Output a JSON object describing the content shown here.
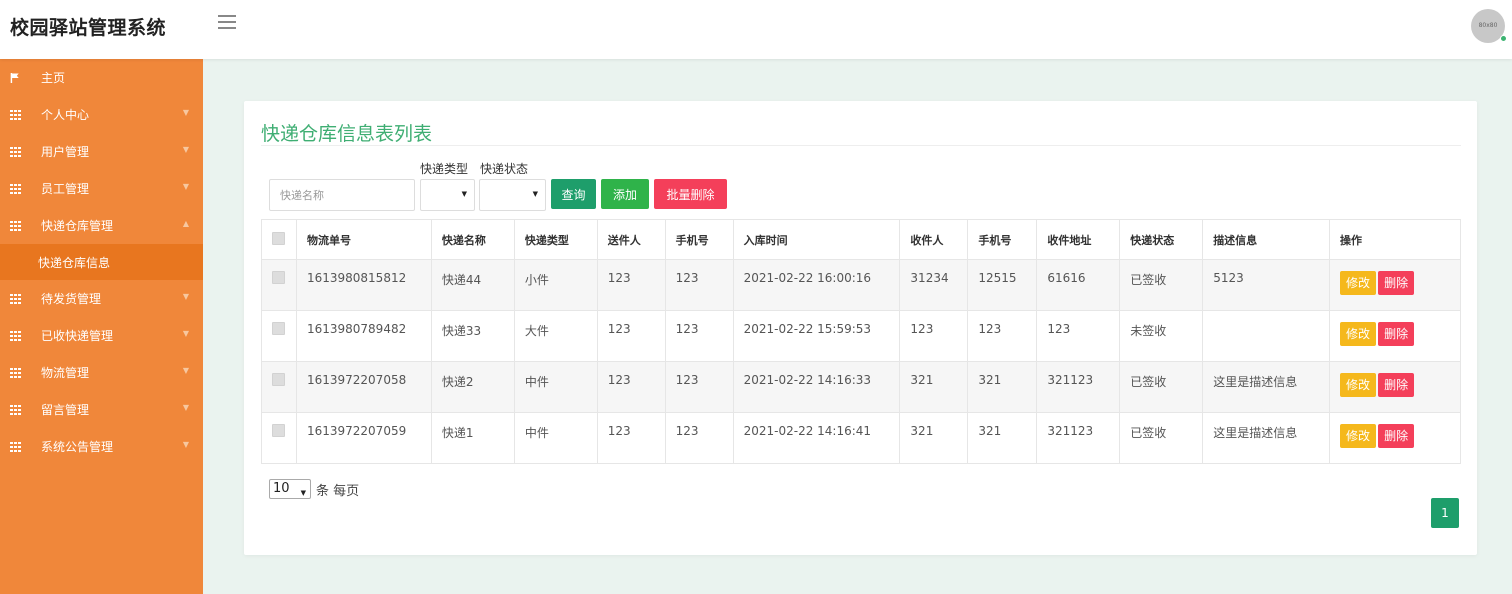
{
  "app": {
    "title": "校园驿站管理系统",
    "avatar_text": "80x80"
  },
  "sidebar": {
    "items": [
      {
        "label": "主页",
        "icon": "flag-icon"
      },
      {
        "label": "个人中心",
        "icon": "grid-icon"
      },
      {
        "label": "用户管理",
        "icon": "grid-icon"
      },
      {
        "label": "员工管理",
        "icon": "grid-icon"
      },
      {
        "label": "快递仓库管理",
        "icon": "grid-icon",
        "expanded": true
      },
      {
        "label": "待发货管理",
        "icon": "grid-icon"
      },
      {
        "label": "已收快递管理",
        "icon": "grid-icon"
      },
      {
        "label": "物流管理",
        "icon": "grid-icon"
      },
      {
        "label": "留言管理",
        "icon": "grid-icon"
      },
      {
        "label": "系统公告管理",
        "icon": "grid-icon"
      }
    ],
    "sub_item": "快递仓库信息"
  },
  "page": {
    "title": "快递仓库信息表列表"
  },
  "filters": {
    "name_placeholder": "快递名称",
    "type_label": "快递类型",
    "status_label": "快递状态"
  },
  "buttons": {
    "query": "查询",
    "add": "添加",
    "batch_delete": "批量删除"
  },
  "table": {
    "headers": [
      "物流单号",
      "快递名称",
      "快递类型",
      "送件人",
      "手机号",
      "入库时间",
      "收件人",
      "手机号",
      "收件地址",
      "快递状态",
      "描述信息",
      "操作"
    ],
    "rows": [
      [
        "1613980815812",
        "快递44",
        "小件",
        "123",
        "123",
        "2021-02-22 16:00:16",
        "31234",
        "12515",
        "61616",
        "已签收",
        "5123"
      ],
      [
        "1613980789482",
        "快递33",
        "大件",
        "123",
        "123",
        "2021-02-22 15:59:53",
        "123",
        "123",
        "123",
        "未签收",
        ""
      ],
      [
        "1613972207058",
        "快递2",
        "中件",
        "123",
        "123",
        "2021-02-22 14:16:33",
        "321",
        "321",
        "321123",
        "已签收",
        "这里是描述信息"
      ],
      [
        "1613972207059",
        "快递1",
        "中件",
        "123",
        "123",
        "2021-02-22 14:16:41",
        "321",
        "321",
        "321123",
        "已签收",
        "这里是描述信息"
      ]
    ],
    "edit_label": "修改",
    "delete_label": "删除"
  },
  "pagination": {
    "page_size": "10",
    "page_size_label": "条 每页",
    "current_page": "1"
  },
  "colors": {
    "sidebar": "#f0873a",
    "title": "#3fae73",
    "query": "#1e9e6b",
    "add": "#2fb34a",
    "danger": "#f43f5a",
    "edit": "#f5b81c"
  }
}
